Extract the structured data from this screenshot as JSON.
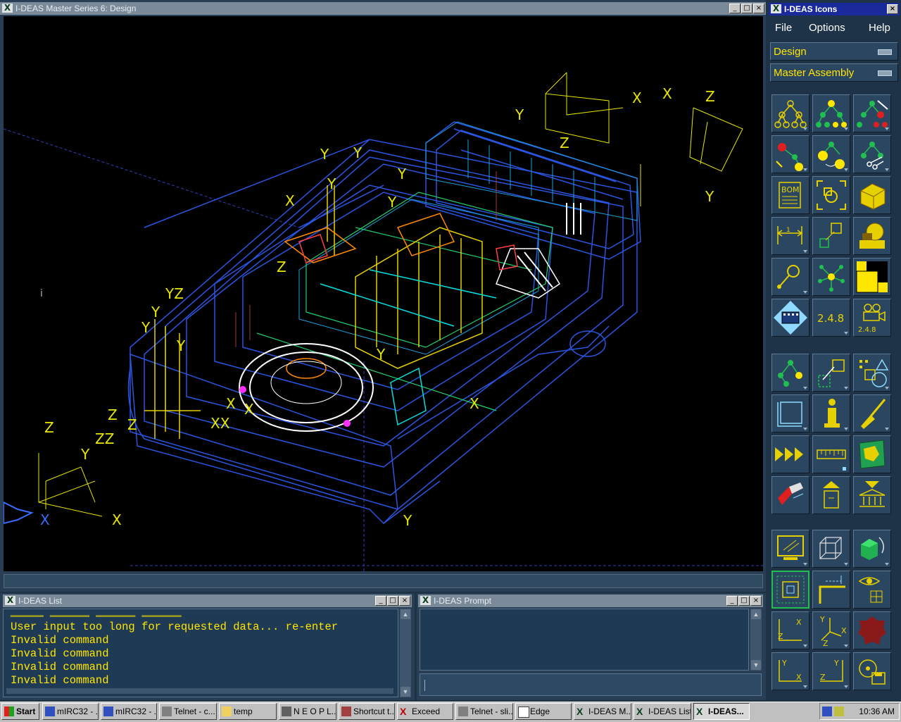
{
  "main_window": {
    "title": "I-DEAS Master Series 6:    Design"
  },
  "viewport": {
    "axis_labels": [
      "Y",
      "Z",
      "X",
      "X",
      "Z",
      "Y",
      "Y",
      "Y",
      "Y",
      "Y",
      "Y",
      "X",
      "Z",
      "YZ",
      "Y",
      "Y",
      "Y",
      "Z",
      "Z",
      "ZZ",
      "Z",
      "XX",
      "X",
      "X",
      "X",
      "Y",
      "X",
      "Y",
      "Y",
      "X"
    ],
    "small_mark": "i"
  },
  "list_window": {
    "title": "I-DEAS List",
    "lines": [
      "User input too long for requested data... re-enter",
      "Invalid command",
      "Invalid command",
      "Invalid command",
      "Invalid command"
    ]
  },
  "prompt_window": {
    "title": "I-DEAS Prompt",
    "input_value": ""
  },
  "icons_panel": {
    "title": "I-DEAS Icons",
    "menu": [
      "File",
      "Options",
      "Help"
    ],
    "application": "Design",
    "task": "Master Assembly",
    "icons": [
      "hierarchy-icon",
      "hierarchy-select-icon",
      "hierarchy-remove-icon",
      "add-to-hierarchy-icon",
      "swap-instance-icon",
      "cut-hierarchy-icon",
      "bom-icon",
      "fit-frame-icon",
      "part-library-icon",
      "dimension-icon",
      "place-instance-icon",
      "robot-arm-icon",
      "relocate-icon",
      "network-icon",
      "layer-icon",
      "film-strip-icon",
      "numbers-icon",
      "camera-numbers-icon",
      "constraint-icon",
      "reorient-icon",
      "shapes-icon",
      "sketch-plane-icon",
      "info-icon",
      "paintbrush-icon",
      "forward-arrows-icon",
      "ruler-icon",
      "book-icon",
      "eraser-icon",
      "put-away-icon",
      "store-icon",
      "monitor-icon",
      "wireframe-cube-icon",
      "shaded-cube-icon",
      "zoom-box-icon",
      "corner-icon",
      "eye-icon",
      "view-xz-icon",
      "view-xyz-icon",
      "red-blob-icon",
      "view-yx-icon",
      "view-zy-icon",
      "disk-icon"
    ],
    "icon_texts": {
      "bom": "BOM",
      "numbers": "2.4.8",
      "numbers_small": "2.4.8"
    }
  },
  "taskbar": {
    "start_label": "Start",
    "items": [
      "mIRC32 - ...",
      "mIRC32 - ...",
      "Telnet - c...",
      "temp",
      "N E O P L...",
      "Shortcut t...",
      "Exceed",
      "Telnet - sli...",
      "Edge",
      "I-DEAS M...",
      "I-DEAS List",
      "I-DEAS..."
    ],
    "clock": "10:36 AM"
  }
}
